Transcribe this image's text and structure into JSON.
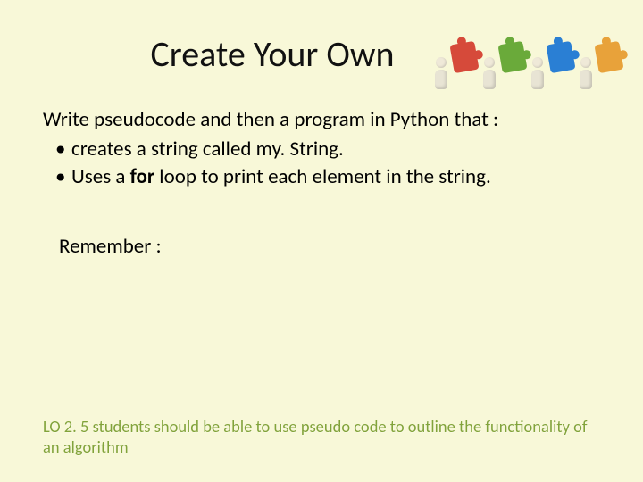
{
  "title": "Create Your Own",
  "intro": "Write pseudocode and then a program in Python that :",
  "bullets": [
    {
      "pre": "creates a string called my. String.",
      "bold": "",
      "post": ""
    },
    {
      "pre": "Uses a ",
      "bold": "for",
      "post": " loop to print each element in the string."
    }
  ],
  "remember": "Remember :",
  "footer": "LO 2. 5 students should be able to use pseudo code to outline the functionality of an algorithm",
  "clipart_alt": "figures-holding-puzzle-pieces"
}
